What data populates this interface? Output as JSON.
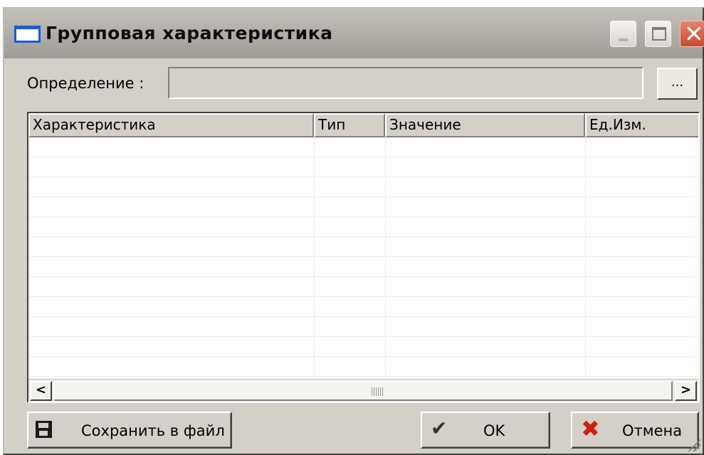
{
  "window": {
    "title": "Групповая характеристика",
    "controls": {
      "minimize": "minimize",
      "maximize": "maximize",
      "close": "close"
    }
  },
  "definition": {
    "label": "Определение :",
    "value": "",
    "browse_label": "..."
  },
  "grid": {
    "columns": [
      "Характеристика",
      "Тип",
      "Значение",
      "Ед.Изм."
    ],
    "rows": [
      [],
      [],
      [],
      [],
      [],
      [],
      [],
      [],
      [],
      [],
      [],
      []
    ]
  },
  "buttons": {
    "save_label": "Сохранить в файл",
    "ok_label": "OK",
    "cancel_label": "Отмена"
  },
  "icons": {
    "title": "window-icon",
    "save": "floppy-disk-icon",
    "ok": "checkmark-icon",
    "cancel": "red-x-icon"
  },
  "colors": {
    "titlebar": "#a8a59f",
    "face": "#d4d0c8",
    "close_button": "#d8603f",
    "cancel_icon": "#d02010"
  }
}
